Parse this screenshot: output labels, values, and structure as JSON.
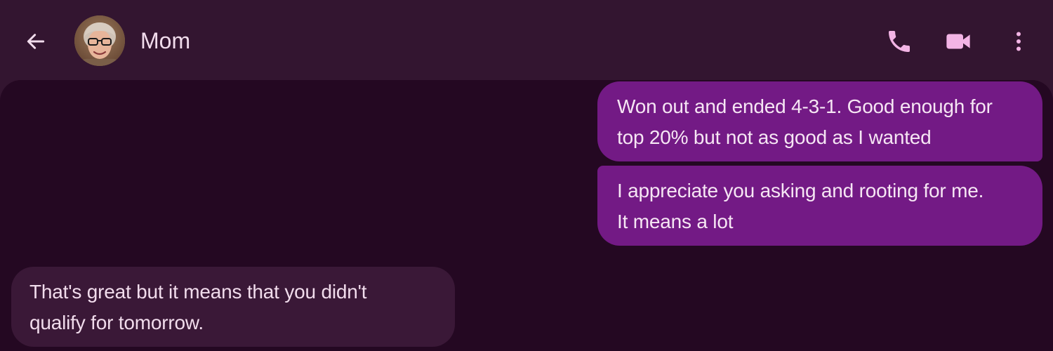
{
  "header": {
    "contact_name": "Mom",
    "back_icon": "arrow-left-icon",
    "call_icon": "phone-icon",
    "video_icon": "video-camera-icon",
    "more_icon": "more-vertical-icon"
  },
  "colors": {
    "header_bg": "#331530",
    "thread_bg": "#240822",
    "sent_bubble": "#731a85",
    "received_bubble": "#3a1837",
    "icon_accent": "#f3b4e5",
    "text": "#f1dcec"
  },
  "messages": [
    {
      "direction": "sent",
      "lines": [
        "Won out and ended 4-3-1. Good enough for",
        "top 20% but not as good as I wanted"
      ]
    },
    {
      "direction": "sent",
      "lines": [
        "I appreciate you asking and rooting for me.",
        "It means a lot"
      ]
    },
    {
      "direction": "received",
      "lines": [
        "That's great but it means that you didn't",
        "qualify for tomorrow."
      ]
    }
  ]
}
